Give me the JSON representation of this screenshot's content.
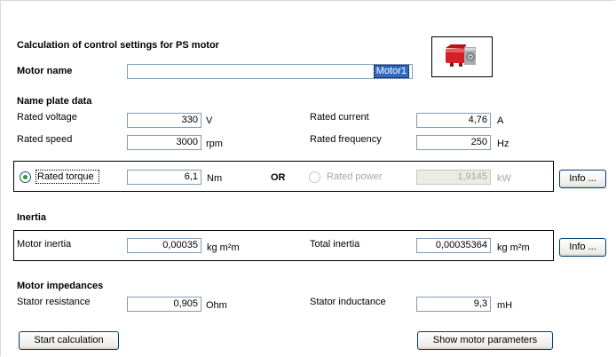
{
  "header": {
    "title": "Calculation of control settings for PS motor",
    "motor_name_label": "Motor name",
    "motor_name_value": "Motor1"
  },
  "nameplate": {
    "section_title": "Name plate data",
    "rated_voltage": {
      "label": "Rated voltage",
      "value": "330",
      "unit": "V"
    },
    "rated_speed": {
      "label": "Rated speed",
      "value": "3000",
      "unit": "rpm"
    },
    "rated_current": {
      "label": "Rated current",
      "value": "4,76",
      "unit": "A"
    },
    "rated_frequency": {
      "label": "Rated frequency",
      "value": "250",
      "unit": "Hz"
    },
    "rated_torque": {
      "label": "Rated torque",
      "value": "6,1",
      "unit": "Nm",
      "selected": true
    },
    "or_label": "OR",
    "rated_power": {
      "label": "Rated power",
      "value": "1,9145",
      "unit": "kW",
      "selected": false
    },
    "info_button": "Info ..."
  },
  "inertia": {
    "section_title": "Inertia",
    "motor_inertia": {
      "label": "Motor inertia",
      "value": "0,00035",
      "unit": "kg m²m"
    },
    "total_inertia": {
      "label": "Total inertia",
      "value": "0,00035364",
      "unit": "kg m²m"
    },
    "info_button": "Info ..."
  },
  "impedances": {
    "section_title": "Motor impedances",
    "stator_resistance": {
      "label": "Stator resistance",
      "value": "0,905",
      "unit": "Ohm"
    },
    "stator_inductance": {
      "label": "Stator inductance",
      "value": "9,3",
      "unit": "mH"
    }
  },
  "actions": {
    "start_calculation": "Start calculation",
    "show_motor_parameters": "Show motor parameters"
  },
  "icons": {
    "motor_image": "servo-motor-icon",
    "accent_color": "#e0202a"
  }
}
